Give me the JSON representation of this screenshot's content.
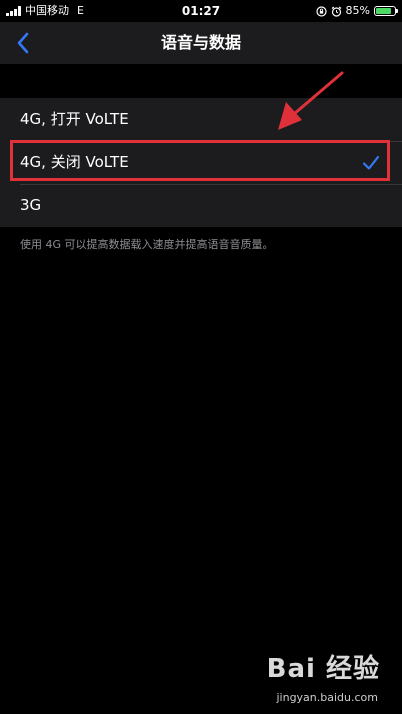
{
  "status_bar": {
    "carrier": "中国移动",
    "network_type": "E",
    "time": "01:27",
    "battery_percent": "85%",
    "battery_level": 0.85,
    "battery_color": "#4cd964"
  },
  "nav": {
    "title": "语音与数据",
    "back_icon": "chevron-left-icon",
    "accent_color": "#3478f6"
  },
  "options": [
    {
      "label": "4G, 打开 VoLTE",
      "selected": false
    },
    {
      "label": "4G, 关闭 VoLTE",
      "selected": true
    },
    {
      "label": "3G",
      "selected": false
    }
  ],
  "footer_note": "使用 4G 可以提高数据载入速度并提高语音音质量。",
  "annotation": {
    "highlight_color": "#e0303a",
    "arrow_color": "#e0303a"
  },
  "watermark": {
    "logo": "Bai 经验",
    "url": "jingyan.baidu.com"
  }
}
